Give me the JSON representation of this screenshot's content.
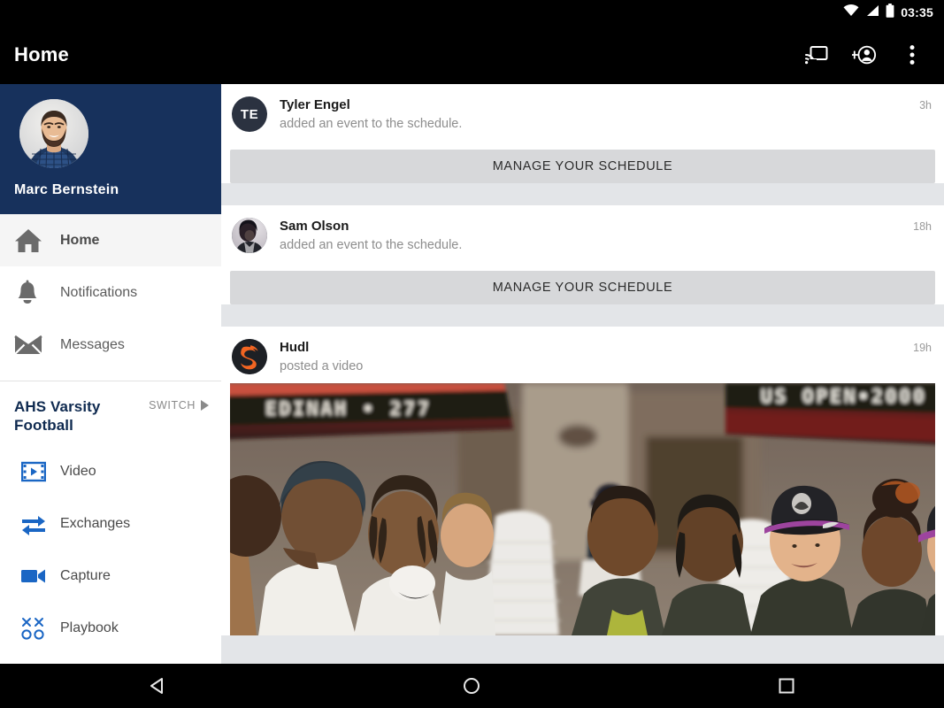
{
  "status_bar": {
    "time": "03:35",
    "icons": [
      "wifi-icon",
      "signal-icon",
      "battery-icon"
    ]
  },
  "app_bar": {
    "title": "Home",
    "actions": [
      {
        "name": "cast-icon",
        "label": "Cast"
      },
      {
        "name": "add-person-icon",
        "label": "Add person"
      },
      {
        "name": "overflow-menu-icon",
        "label": "More options"
      }
    ]
  },
  "sidebar": {
    "user": {
      "name": "Marc Bernstein",
      "avatar": "user-avatar-photo"
    },
    "nav_items": [
      {
        "label": "Home",
        "icon": "home-icon",
        "selected": true
      },
      {
        "label": "Notifications",
        "icon": "bell-icon",
        "selected": false
      },
      {
        "label": "Messages",
        "icon": "envelope-icon",
        "selected": false
      }
    ],
    "team": {
      "name": "AHS Varsity Football",
      "switch_label": "SWITCH",
      "switch_icon": "triangle-right-icon",
      "items": [
        {
          "label": "Video",
          "icon": "film-strip-icon"
        },
        {
          "label": "Exchanges",
          "icon": "exchange-arrows-icon"
        },
        {
          "label": "Capture",
          "icon": "video-camera-icon"
        },
        {
          "label": "Playbook",
          "icon": "xs-and-os-icon"
        }
      ]
    }
  },
  "feed": {
    "cards": [
      {
        "poster": "Tyler Engel",
        "action": "added an event to the schedule.",
        "age": "3h",
        "avatar_type": "initials",
        "initials": "TE",
        "cta": "MANAGE YOUR SCHEDULE"
      },
      {
        "poster": "Sam Olson",
        "action": "added an event to the schedule.",
        "age": "18h",
        "avatar_type": "photo",
        "initials": "",
        "cta": "MANAGE YOUR SCHEDULE"
      },
      {
        "poster": "Hudl",
        "action": "posted a video",
        "age": "19h",
        "avatar_type": "logo",
        "initials": "",
        "cta": ""
      }
    ],
    "video_post": {
      "banner_left": "EDINAH • 277",
      "banner_right": "US OPEN • 2000"
    }
  },
  "nav_bar": {
    "buttons": [
      {
        "name": "back-button",
        "icon": "triangle-left-icon"
      },
      {
        "name": "home-button",
        "icon": "circle-icon"
      },
      {
        "name": "recents-button",
        "icon": "square-icon"
      }
    ]
  },
  "colors": {
    "sidebar_header": "#17315c",
    "team_accent": "#1a66c4",
    "feed_background": "#e3e5e8",
    "cta_background": "#d7d8da",
    "hudl_orange": "#f26522"
  }
}
